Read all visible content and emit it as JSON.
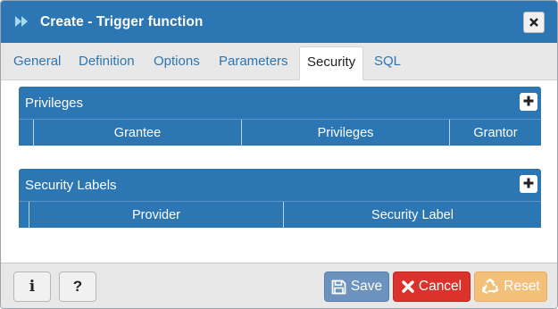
{
  "dialog": {
    "title": "Create - Trigger function",
    "close_icon": "close-icon"
  },
  "tabs": [
    {
      "label": "General",
      "active": false
    },
    {
      "label": "Definition",
      "active": false
    },
    {
      "label": "Options",
      "active": false
    },
    {
      "label": "Parameters",
      "active": false
    },
    {
      "label": "Security",
      "active": true
    },
    {
      "label": "SQL",
      "active": false
    }
  ],
  "privileges": {
    "title": "Privileges",
    "add_icon": "plus-icon",
    "columns": [
      "Grantee",
      "Privileges",
      "Grantor"
    ]
  },
  "security_labels": {
    "title": "Security Labels",
    "add_icon": "plus-icon",
    "columns": [
      "Provider",
      "Security Label"
    ]
  },
  "footer": {
    "info_label": "i",
    "help_label": "?",
    "save_label": "Save",
    "cancel_label": "Cancel",
    "reset_label": "Reset"
  },
  "colors": {
    "accent": "#2c76b3",
    "save": "#6b93bd",
    "cancel": "#d9332c",
    "reset": "#f3c07a"
  }
}
